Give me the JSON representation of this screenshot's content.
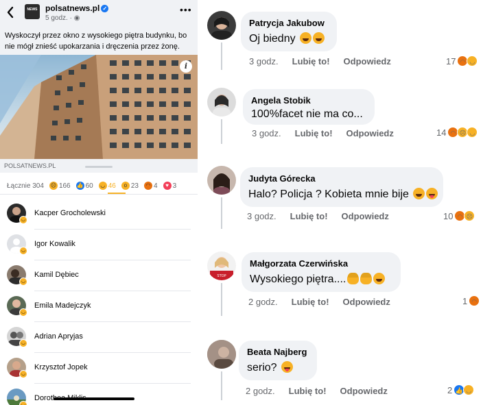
{
  "post": {
    "back_icon": "chevron-left-icon",
    "page_name": "polsatnews.pl",
    "logo_text": "NEWS",
    "time": "5 godz. · ",
    "globe_icon": "globe-icon",
    "more_icon": "more-horizontal-icon",
    "text": "Wyskoczył przez okno z wysokiego piętra budynku, bo nie mógł znieść upokarzania i dręczenia przez żonę.",
    "info_icon": "i",
    "source": "POLSATNEWS.PL"
  },
  "reactions_sheet": {
    "total_label": "Łącznie 304",
    "tabs": [
      {
        "icon": "sad-emoji-icon",
        "count": "166"
      },
      {
        "icon": "like-icon",
        "count": "60"
      },
      {
        "icon": "haha-emoji-icon",
        "count": "46"
      },
      {
        "icon": "wow-emoji-icon",
        "count": "23"
      },
      {
        "icon": "angry-emoji-icon",
        "count": "4"
      },
      {
        "icon": "love-icon",
        "count": "3"
      }
    ],
    "people": [
      {
        "name": "Kacper Grocholewski"
      },
      {
        "name": "Igor Kowalik"
      },
      {
        "name": "Kamil Dębiec"
      },
      {
        "name": "Emila Madejczyk"
      },
      {
        "name": "Adrian Apryjas"
      },
      {
        "name": "Krzysztof Jopek"
      },
      {
        "name": "Dorothea Miklis"
      }
    ]
  },
  "comments": [
    {
      "author": "Patrycja Jakubow",
      "text": "Oj biedny ",
      "time": "3 godz.",
      "like": "Lubię to!",
      "reply": "Odpowiedz",
      "reactions": "17"
    },
    {
      "author": "Angela Stobik",
      "text": "100%facet nie ma co...",
      "time": "3 godz.",
      "like": "Lubię to!",
      "reply": "Odpowiedz",
      "reactions": "14"
    },
    {
      "author": "Judyta Górecka",
      "text": "Halo? Policja ? Kobieta mnie bije ",
      "time": "3 godz.",
      "like": "Lubię to!",
      "reply": "Odpowiedz",
      "reactions": "10"
    },
    {
      "author": "Małgorzata Czerwińska",
      "text": "Wysokiego piętra....",
      "time": "2 godz.",
      "like": "Lubię to!",
      "reply": "Odpowiedz",
      "reactions": "1"
    },
    {
      "author": "Beata Najberg",
      "text": "serio? ",
      "time": "2 godz.",
      "like": "Lubię to!",
      "reply": "Odpowiedz",
      "reactions": "2"
    }
  ],
  "colors": {
    "accent": "#1877f2",
    "haha": "#f7b125",
    "angry": "#e9710f",
    "bubble": "#f0f2f5"
  }
}
